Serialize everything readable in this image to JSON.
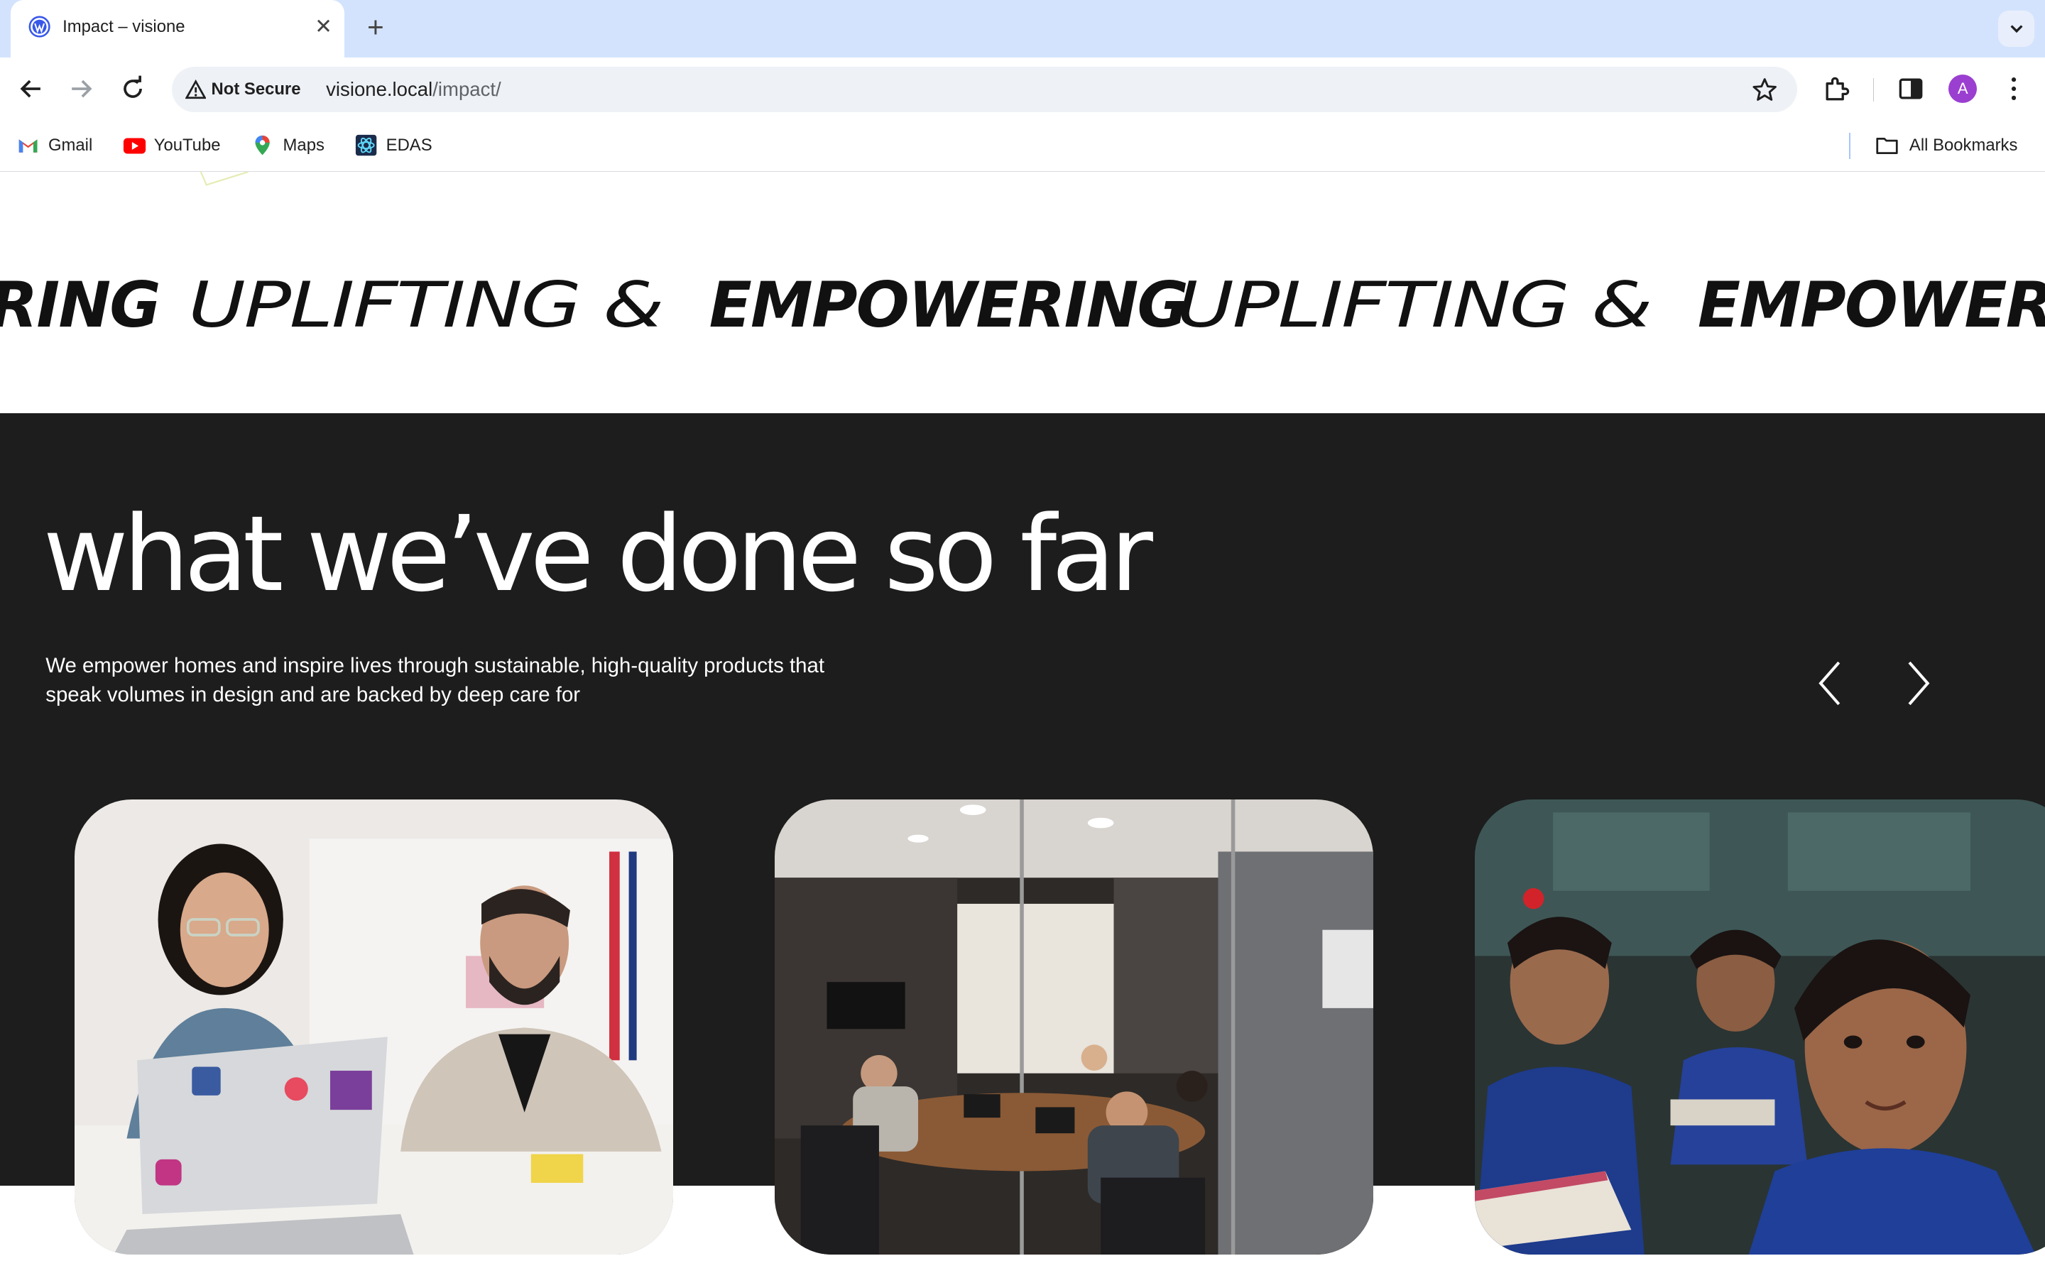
{
  "browser": {
    "tab": {
      "title": "Impact – visione",
      "favicon": "wordpress-icon"
    },
    "new_tab_symbol": "+",
    "omnibox": {
      "security_label": "Not Secure",
      "url_host": "visione.local",
      "url_path": "/impact/"
    },
    "profile_initial": "A",
    "bookmarks": [
      {
        "label": "Gmail",
        "icon": "gmail-icon"
      },
      {
        "label": "YouTube",
        "icon": "youtube-icon"
      },
      {
        "label": "Maps",
        "icon": "maps-icon"
      },
      {
        "label": "EDAS",
        "icon": "edas-icon"
      }
    ],
    "all_bookmarks_label": "All Bookmarks"
  },
  "page": {
    "marquee": {
      "tail": "RING",
      "light_word": "UPLIFTING &",
      "bold_word": "EMPOWERING",
      "light_word_2": "UPLIFTING &",
      "bold_word_2": "EMPOWER"
    },
    "headline": "what we’ve done so far",
    "lede": "We empower homes and inspire lives through sustainable, high-quality products that speak volumes in design and are backed by deep care for",
    "carousel": {
      "prev_icon": "chevron-left-icon",
      "next_icon": "chevron-right-icon",
      "cards": [
        {
          "image": "two-colleagues-at-table-photo"
        },
        {
          "image": "glass-conference-room-meeting-photo"
        },
        {
          "image": "schoolgirls-reading-classroom-photo"
        }
      ]
    }
  },
  "colors": {
    "tabbar": "#d3e3fd",
    "dark_section": "#1d1d1d",
    "avatar": "#9b3fd0"
  }
}
